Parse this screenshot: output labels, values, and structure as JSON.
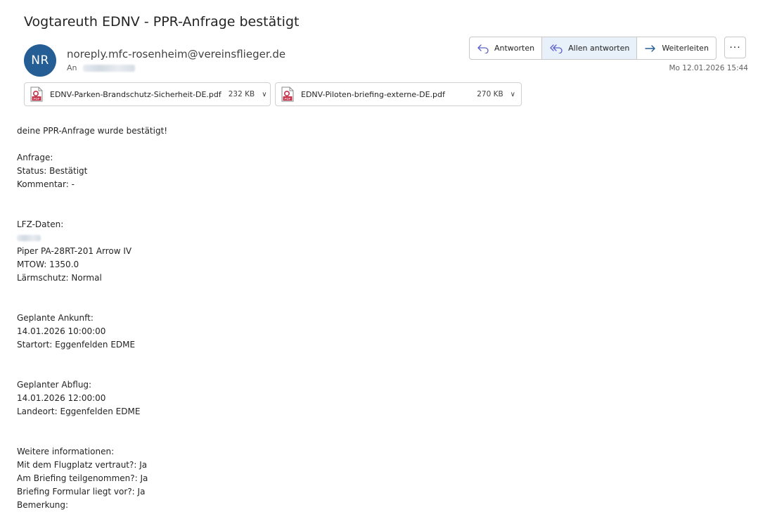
{
  "subject": "Vogtareuth EDNV - PPR-Anfrage bestätigt",
  "sender": {
    "initials": "NR",
    "email": "noreply.mfc-rosenheim@vereinsflieger.de",
    "to_label": "An",
    "avatar_color": "#255e95"
  },
  "actions": {
    "reply": "Antworten",
    "reply_all": "Allen antworten",
    "forward": "Weiterleiten",
    "more": "···",
    "icons": [
      "reply-icon",
      "reply-all-icon",
      "forward-icon",
      "more-icon"
    ]
  },
  "date": "Mo 12.01.2026 15:44",
  "attachments": [
    {
      "name": "EDNV-Parken-Brandschutz-Sicherheit-DE.pdf",
      "size": "232 KB",
      "icon": "pdf-icon"
    },
    {
      "name": "EDNV-Piloten-briefing-externe-DE.pdf",
      "size": "270 KB",
      "icon": "pdf-icon"
    }
  ],
  "body": {
    "greeting": "deine PPR-Anfrage wurde bestätigt!",
    "request_header": "Anfrage:",
    "status": "Status: Bestätigt",
    "comment": "Kommentar: -",
    "aircraft_header": "LFZ-Daten:",
    "aircraft_type": "Piper PA-28RT-201 Arrow IV",
    "mtow": "MTOW: 1350.0",
    "noise": "Lärmschutz: Normal",
    "arrival_header": "Geplante Ankunft:",
    "arrival_time": "14.01.2026 10:00:00",
    "departure_from": "Startort: Eggenfelden EDME",
    "departure_header": "Geplanter Abflug:",
    "departure_time": "14.01.2026 12:00:00",
    "destination": "Landeort: Eggenfelden EDME",
    "info_header": "Weitere informationen:",
    "familiar": "Mit dem Flugplatz vertraut?: Ja",
    "briefing_attended": "Am Briefing teilgenommen?: Ja",
    "briefing_form": "Briefing Formular liegt vor?: Ja",
    "remark": "Bemerkung:"
  }
}
